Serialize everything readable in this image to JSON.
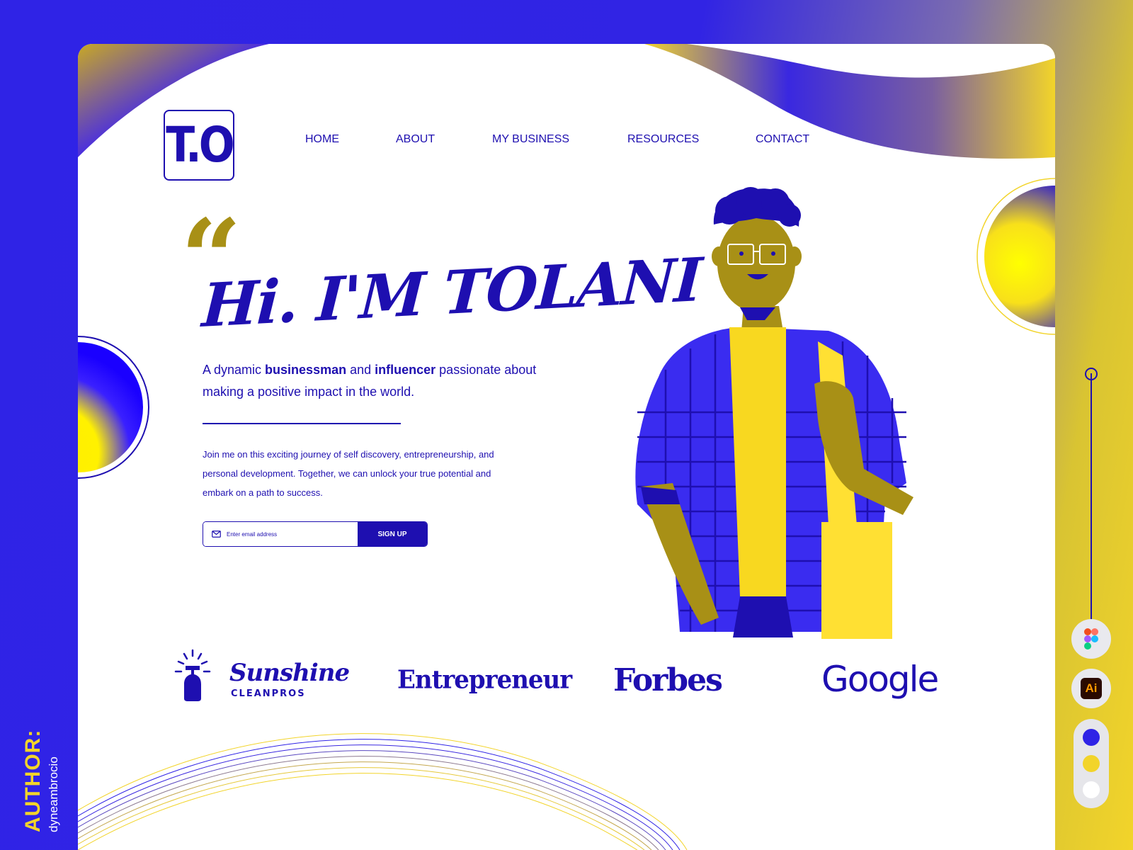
{
  "brand": {
    "logo_text": "T.O"
  },
  "nav": {
    "items": [
      "HOME",
      "ABOUT",
      "MY BUSINESS",
      "RESOURCES",
      "CONTACT"
    ]
  },
  "hero": {
    "quote_mark": "“",
    "headline": "Hi. I'M TOLANI",
    "intro": {
      "p1": "A dynamic ",
      "b1": "businessman",
      "p2": " and ",
      "b2": "influencer",
      "p3": " passionate about making a positive impact in the world."
    },
    "body": "Join me on this exciting journey of self discovery, entrepreneurship, and personal development. Together, we can unlock your true potential and embark on a path to success.",
    "signup": {
      "placeholder": "Enter email address",
      "button": "SIGN UP"
    }
  },
  "partners": {
    "sunshine_title": "Sunshine",
    "sunshine_sub": "CLEANPROS",
    "entrepreneur": "Entrepreneur",
    "forbes": "Forbes",
    "google": "Google"
  },
  "author": {
    "label": "AUTHOR:",
    "name": "dyneambrocio"
  },
  "tools": {
    "illustrator": "Ai",
    "icons": [
      "figma-icon",
      "illustrator-icon"
    ]
  },
  "colors": {
    "primary": "#1e0fb0",
    "accent_blue": "#3124e4",
    "accent_yellow": "#f2d42a",
    "olive": "#a89016",
    "white": "#ffffff"
  }
}
